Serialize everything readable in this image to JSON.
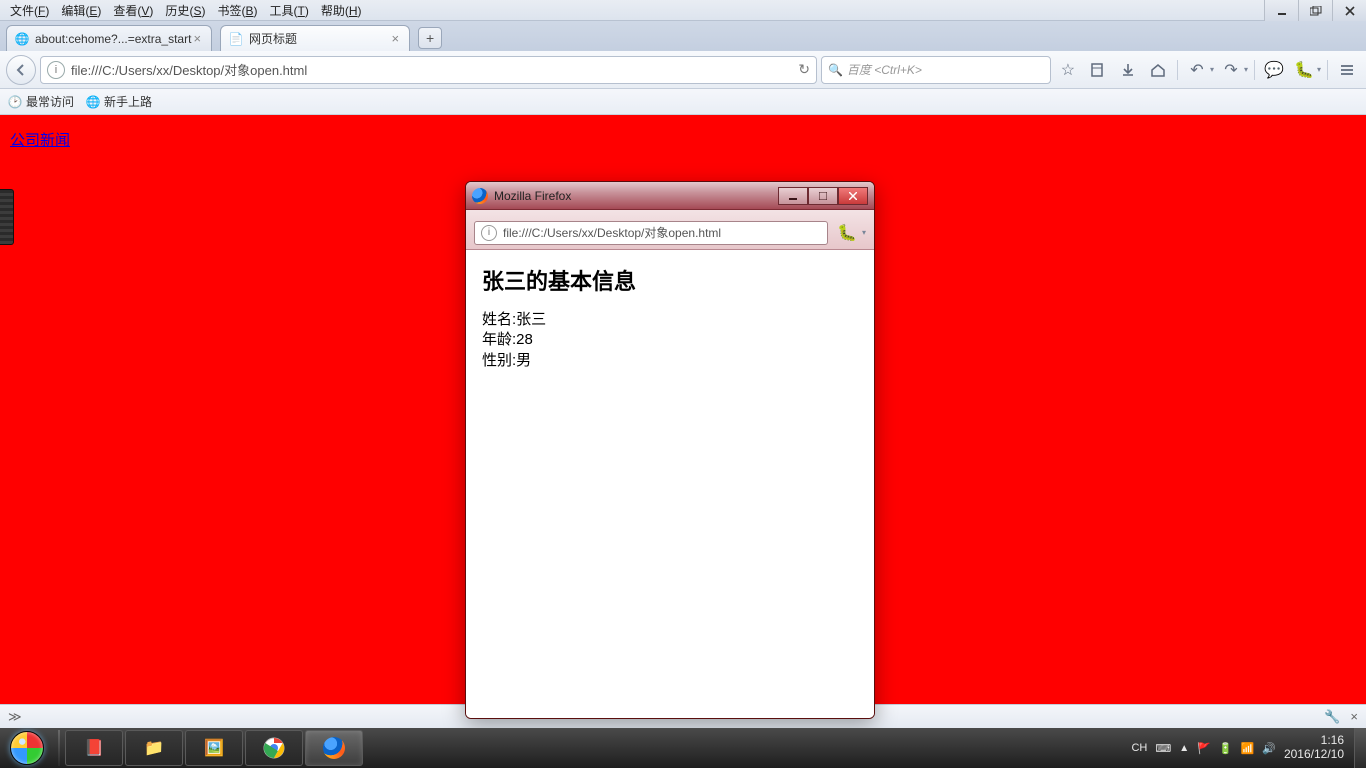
{
  "menubar": {
    "items": [
      {
        "label": "文件",
        "accel": "F"
      },
      {
        "label": "编辑",
        "accel": "E"
      },
      {
        "label": "查看",
        "accel": "V"
      },
      {
        "label": "历史",
        "accel": "S"
      },
      {
        "label": "书签",
        "accel": "B"
      },
      {
        "label": "工具",
        "accel": "T"
      },
      {
        "label": "帮助",
        "accel": "H"
      }
    ]
  },
  "tabs": [
    {
      "title": "about:cehome?...=extra_start",
      "active": false
    },
    {
      "title": "网页标题",
      "active": true
    }
  ],
  "newtab_label": "+",
  "urlbar": {
    "url": "file:///C:/Users/xx/Desktop/对象open.html"
  },
  "searchbar": {
    "placeholder": "百度 <Ctrl+K>"
  },
  "bookmarks_bar": {
    "items": [
      {
        "label": "最常访问"
      },
      {
        "label": "新手上路"
      }
    ]
  },
  "page": {
    "bg_color": "#ff0000",
    "link_text": "公司新闻"
  },
  "popup": {
    "window_title": "Mozilla Firefox",
    "url": "file:///C:/Users/xx/Desktop/对象open.html",
    "heading": "张三的基本信息",
    "lines": [
      "姓名:张三",
      "年龄:28",
      "性别:男"
    ]
  },
  "addonbar": {
    "prompt": "≫"
  },
  "taskbar": {
    "ime": "CH",
    "time": "1:16",
    "date": "2016/12/10"
  }
}
